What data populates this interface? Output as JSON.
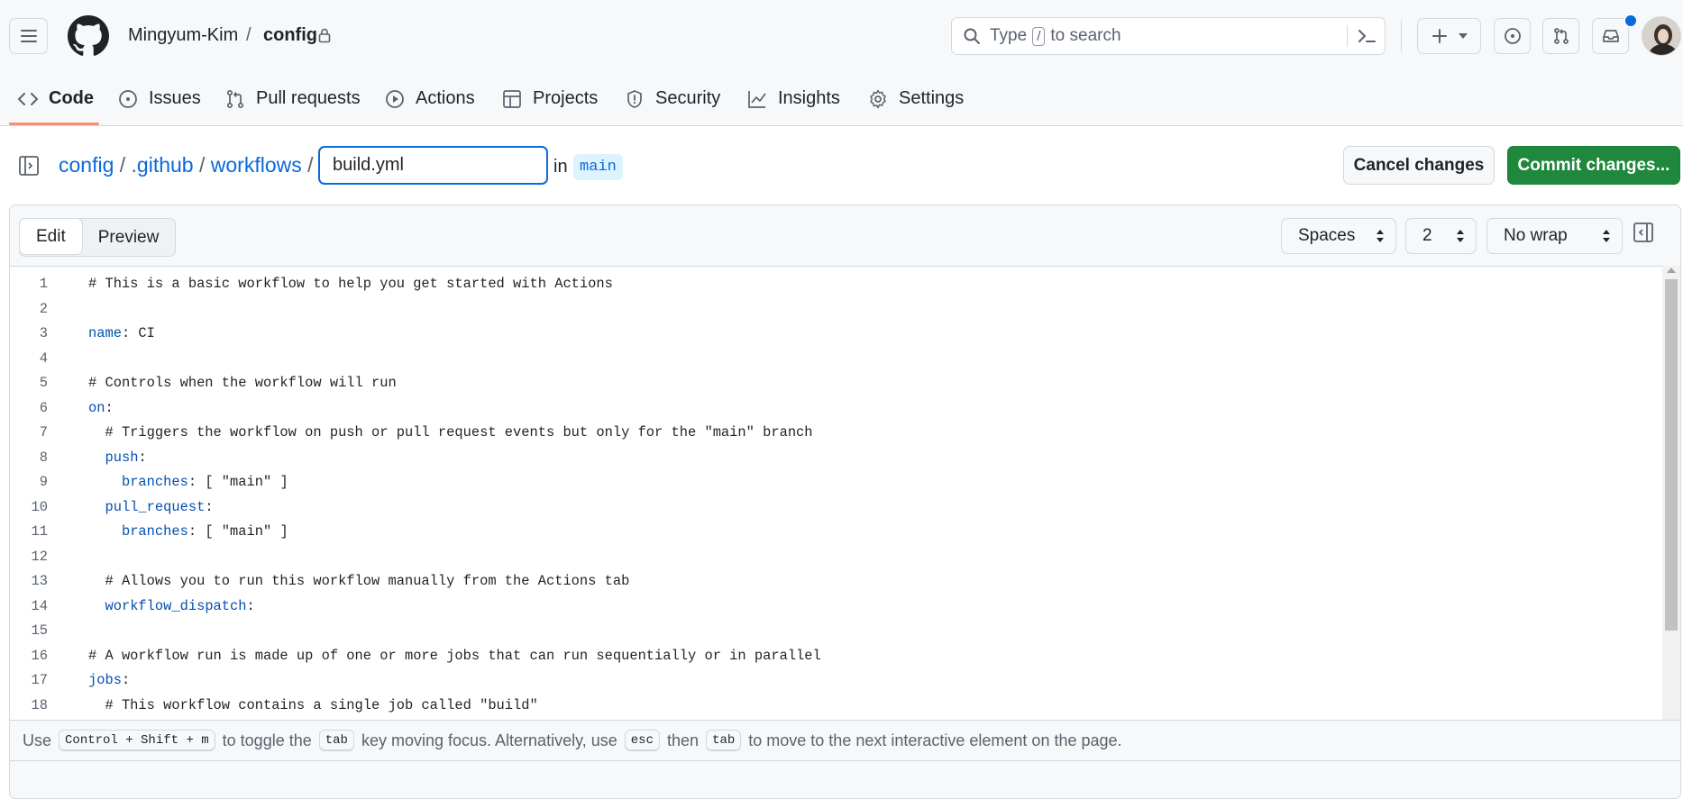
{
  "header": {
    "owner": "Mingyum-Kim",
    "separator": "/",
    "repo": "config",
    "search": {
      "prefix": "Type",
      "key": "/",
      "suffix": "to search"
    },
    "colors": {
      "accent": "#0969da",
      "notification_dot": "#0969da"
    }
  },
  "repo_nav": {
    "items": [
      {
        "label": "Code",
        "icon": "code-icon"
      },
      {
        "label": "Issues",
        "icon": "issue-opened-icon"
      },
      {
        "label": "Pull requests",
        "icon": "git-pull-request-icon"
      },
      {
        "label": "Actions",
        "icon": "play-icon"
      },
      {
        "label": "Projects",
        "icon": "table-icon"
      },
      {
        "label": "Security",
        "icon": "shield-icon"
      },
      {
        "label": "Insights",
        "icon": "graph-icon"
      },
      {
        "label": "Settings",
        "icon": "gear-icon"
      }
    ]
  },
  "file_bar": {
    "breadcrumb": [
      {
        "label": "config"
      },
      {
        "label": ".github"
      },
      {
        "label": "workflows"
      }
    ],
    "sep": "/",
    "filename": "build.yml",
    "in_label": "in",
    "branch": "main",
    "cancel_label": "Cancel changes",
    "commit_label": "Commit changes..."
  },
  "editor": {
    "tabs": {
      "edit": "Edit",
      "preview": "Preview"
    },
    "indent_mode": "Spaces",
    "indent_size": "2",
    "wrap_mode": "No wrap",
    "lines": [
      {
        "n": "1",
        "text": "# This is a basic workflow to help you get started with Actions"
      },
      {
        "n": "2",
        "text": ""
      },
      {
        "n": "3",
        "text": "name: CI"
      },
      {
        "n": "4",
        "text": ""
      },
      {
        "n": "5",
        "text": "# Controls when the workflow will run"
      },
      {
        "n": "6",
        "text": "on:"
      },
      {
        "n": "7",
        "text": "  # Triggers the workflow on push or pull request events but only for the \"main\" branch"
      },
      {
        "n": "8",
        "text": "  push:"
      },
      {
        "n": "9",
        "text": "    branches: [ \"main\" ]"
      },
      {
        "n": "10",
        "text": "  pull_request:"
      },
      {
        "n": "11",
        "text": "    branches: [ \"main\" ]"
      },
      {
        "n": "12",
        "text": ""
      },
      {
        "n": "13",
        "text": "  # Allows you to run this workflow manually from the Actions tab"
      },
      {
        "n": "14",
        "text": "  workflow_dispatch:"
      },
      {
        "n": "15",
        "text": ""
      },
      {
        "n": "16",
        "text": "# A workflow run is made up of one or more jobs that can run sequentially or in parallel"
      },
      {
        "n": "17",
        "text": "jobs:"
      },
      {
        "n": "18",
        "text": "  # This workflow contains a single job called \"build\""
      }
    ],
    "help": {
      "use": "Use",
      "shortcut": "Control + Shift + m",
      "to_toggle_the": "to toggle the",
      "tab_key": "tab",
      "key_moving_focus": "key moving focus. Alternatively, use",
      "esc_key": "esc",
      "then": "then",
      "tab_key2": "tab",
      "to_move": "to move to the next interactive element on the page."
    }
  }
}
